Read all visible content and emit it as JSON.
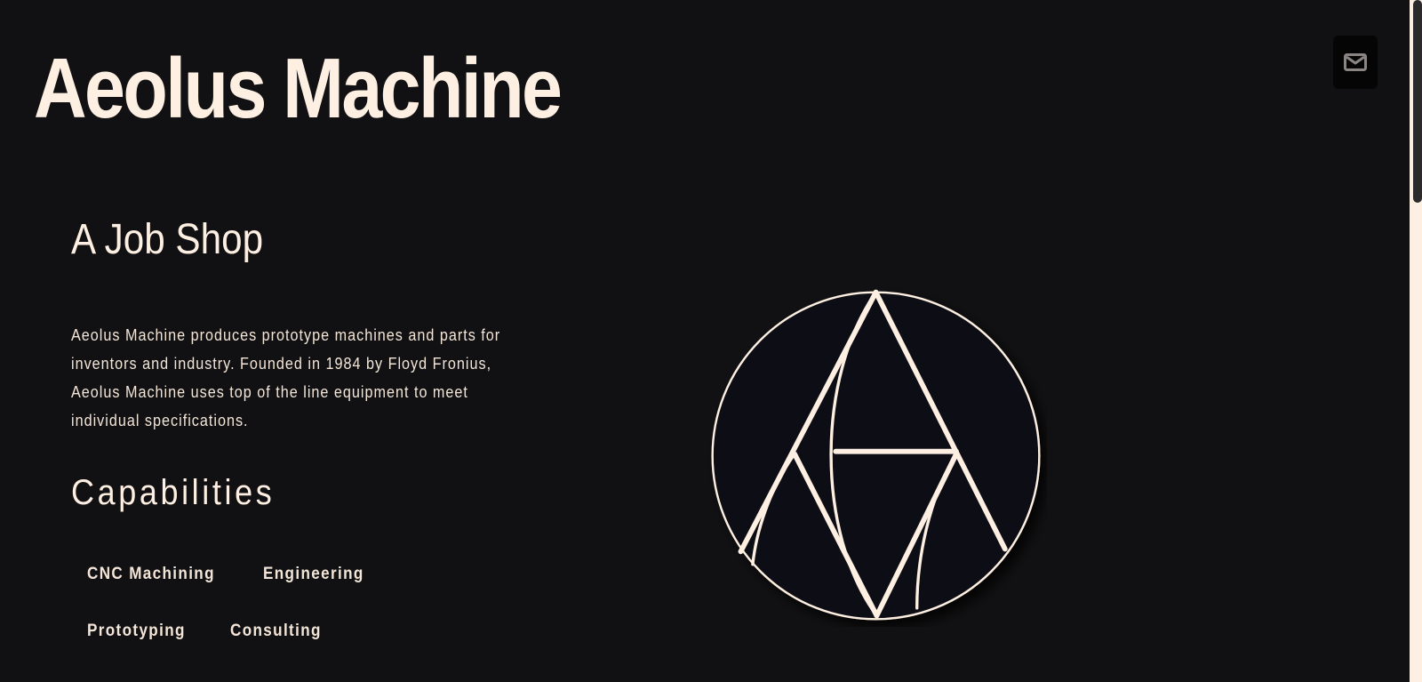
{
  "header": {
    "title": "Aeolus Machine",
    "contact_icon": "envelope-icon"
  },
  "main": {
    "heading": "A Job Shop",
    "intro": "Aeolus Machine produces prototype machines and parts for inventors and industry. Founded in 1984 by Floyd Fronius, Aeolus Machine uses top of the line equipment to meet individual specifications.",
    "capabilities_heading": "Capabilities",
    "capabilities": [
      "CNC Machining",
      "Engineering",
      "Prototyping",
      "Consulting"
    ]
  },
  "logo": {
    "icon": "aeolus-a-logo-icon"
  },
  "colors": {
    "background": "#111012",
    "text": "#fdf0e2",
    "button": "#050505"
  }
}
